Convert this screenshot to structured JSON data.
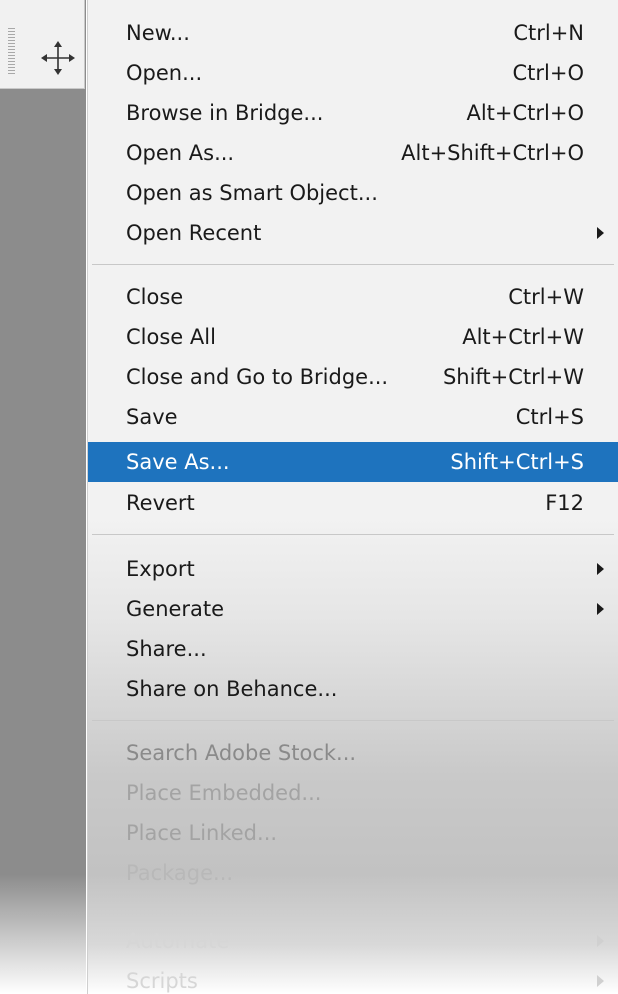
{
  "menu": {
    "items": [
      {
        "label": "New...",
        "shortcut": "Ctrl+N"
      },
      {
        "label": "Open...",
        "shortcut": "Ctrl+O"
      },
      {
        "label": "Browse in Bridge...",
        "shortcut": "Alt+Ctrl+O"
      },
      {
        "label": "Open As...",
        "shortcut": "Alt+Shift+Ctrl+O"
      },
      {
        "label": "Open as Smart Object...",
        "shortcut": ""
      },
      {
        "label": "Open Recent",
        "shortcut": "",
        "submenu": true
      },
      {
        "label": "Close",
        "shortcut": "Ctrl+W"
      },
      {
        "label": "Close All",
        "shortcut": "Alt+Ctrl+W"
      },
      {
        "label": "Close and Go to Bridge...",
        "shortcut": "Shift+Ctrl+W"
      },
      {
        "label": "Save",
        "shortcut": "Ctrl+S"
      },
      {
        "label": "Save As...",
        "shortcut": "Shift+Ctrl+S",
        "selected": true
      },
      {
        "label": "Revert",
        "shortcut": "F12"
      },
      {
        "label": "Export",
        "shortcut": "",
        "submenu": true
      },
      {
        "label": "Generate",
        "shortcut": "",
        "submenu": true
      },
      {
        "label": "Share...",
        "shortcut": ""
      },
      {
        "label": "Share on Behance...",
        "shortcut": ""
      },
      {
        "label": "Search Adobe Stock...",
        "shortcut": "",
        "enabled": false
      },
      {
        "label": "Place Embedded...",
        "shortcut": "",
        "enabled": false
      },
      {
        "label": "Place Linked...",
        "shortcut": "",
        "enabled": false
      },
      {
        "label": "Package...",
        "shortcut": "",
        "enabled": false
      },
      {
        "label": "Automate",
        "shortcut": "",
        "submenu": true,
        "enabled": false
      },
      {
        "label": "Scripts",
        "shortcut": "",
        "submenu": true,
        "enabled": false
      }
    ]
  },
  "toolbar": {
    "active_tool_icon": "move-tool-icon"
  },
  "colors": {
    "selection": "#1e73be",
    "menu_bg": "#f2f2f2",
    "toolbar_bg": "#8c8c8c"
  }
}
